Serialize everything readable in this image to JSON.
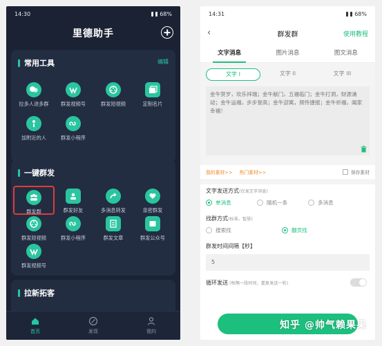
{
  "left": {
    "status": {
      "time": "14:30",
      "battery": "68%"
    },
    "title": "里德助手",
    "tools": {
      "title": "常用工具",
      "edit": "编辑",
      "items": [
        {
          "label": "拉多人进多群",
          "icon": "people-chat-icon"
        },
        {
          "label": "群发视频号",
          "icon": "video-channel-icon"
        },
        {
          "label": "群发短视频",
          "icon": "film-icon"
        },
        {
          "label": "定制名片",
          "icon": "card-icon"
        },
        {
          "label": "加附近的人",
          "icon": "location-person-icon"
        },
        {
          "label": "群发小程序",
          "icon": "mini-program-icon"
        }
      ]
    },
    "mass": {
      "title": "一键群发",
      "items": [
        {
          "label": "群发群",
          "icon": "group-icon"
        },
        {
          "label": "群发好友",
          "icon": "friend-icon"
        },
        {
          "label": "多消息转发",
          "icon": "forward-icon"
        },
        {
          "label": "亲密群发",
          "icon": "heart-chat-icon"
        },
        {
          "label": "群发短视频",
          "icon": "film-icon"
        },
        {
          "label": "群发小程序",
          "icon": "mini-program-icon"
        },
        {
          "label": "群发文章",
          "icon": "article-icon"
        },
        {
          "label": "群发公众号",
          "icon": "official-account-icon"
        },
        {
          "label": "群发视频号",
          "icon": "video-channel-icon"
        }
      ]
    },
    "expand": {
      "title": "拉新拓客"
    },
    "nav": [
      {
        "label": "首页",
        "icon": "home-icon"
      },
      {
        "label": "发现",
        "icon": "compass-icon"
      },
      {
        "label": "我的",
        "icon": "user-icon"
      }
    ],
    "accent": "#25c6a6"
  },
  "right": {
    "status": {
      "time": "14:31",
      "battery": "68%"
    },
    "title": "群发群",
    "help": "使用教程",
    "tabs": [
      "文字消息",
      "图片消息",
      "图文消息"
    ],
    "subtabs": [
      "文字 I",
      "文字 II",
      "文字 III"
    ],
    "message": "金牛贺岁，欢乐祥瑞；金牛献门，五福临门；金牛打洞，财源涌动；金牛运福，步步登高；金牛迎寓，频传捷报；金牛祈福，阖家幸福！",
    "links": [
      "我的素材>>",
      "热门素材>>"
    ],
    "save": "保存素材",
    "method": {
      "title": "文字发送方式",
      "hint": "(仅发文字消息)",
      "options": [
        "单消息",
        "随机一条",
        "多消息"
      ]
    },
    "find": {
      "title": "找群方式",
      "hint": "(标准，智慧)",
      "options": [
        "搜索找",
        "翻页找"
      ]
    },
    "interval": {
      "title": "群发时间间隔【秒】",
      "value": "5"
    },
    "loop": {
      "title": "循环发送",
      "hint": "(每隔一段时间，重复发送一轮)"
    },
    "watermark": "知乎 @帅气赖果果",
    "accent": "#1dbf7e"
  }
}
